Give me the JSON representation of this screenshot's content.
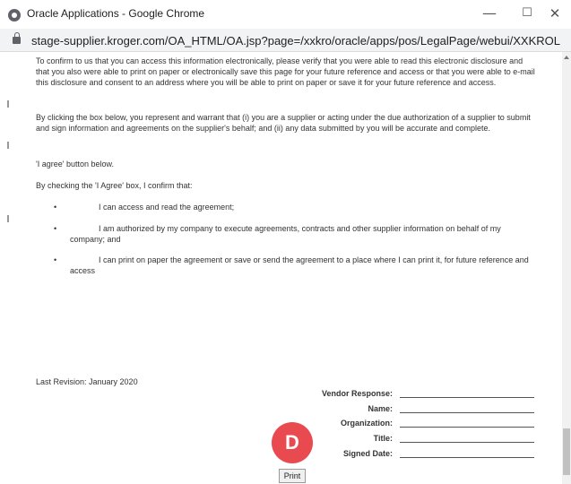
{
  "window": {
    "title": "Oracle Applications - Google Chrome",
    "minimize": "—",
    "maximize": "☐",
    "close": "✕"
  },
  "address": {
    "url": "stage-supplier.kroger.com/OA_HTML/OA.jsp?page=/xxkro/oracle/apps/pos/LegalPage/webui/XXKROLegalPopupRN&ret..."
  },
  "document": {
    "paragraph1": "To confirm to us that you can access this information electronically, please verify that you were able to read this electronic disclosure and that you also were able to print on paper or electronically save this page for your future reference and access or that you were able to e-mail this disclosure and consent to an address where you will be able to print on paper or save it for your future reference and access.",
    "paragraph2": "By clicking the box below, you represent and warrant that (i) you are a supplier or acting under the due authorization of a supplier to submit and sign information and agreements on the supplier's behalf; and (ii) any data submitted by you will be accurate and complete.",
    "paragraph3": "'I agree' button below.",
    "paragraph4": "By checking the 'I Agree' box, I confirm that:",
    "bullet_symbol": "•",
    "bullets": [
      "I can access and read the agreement;",
      "I am authorized by my company to execute agreements, contracts and other supplier information on behalf of my company; and",
      "I can print on paper the agreement or save or send the agreement to a place where I can print it, for future reference and access"
    ],
    "last_revision": "Last Revision: January 2020"
  },
  "form": {
    "vendor_response_label": "Vendor Response:",
    "name_label": "Name:",
    "organization_label": "Organization:",
    "title_label": "Title:",
    "signed_date_label": "Signed Date:"
  },
  "avatar": {
    "letter": "D",
    "color": "#e84a4f"
  },
  "actions": {
    "print_label": "Print"
  }
}
